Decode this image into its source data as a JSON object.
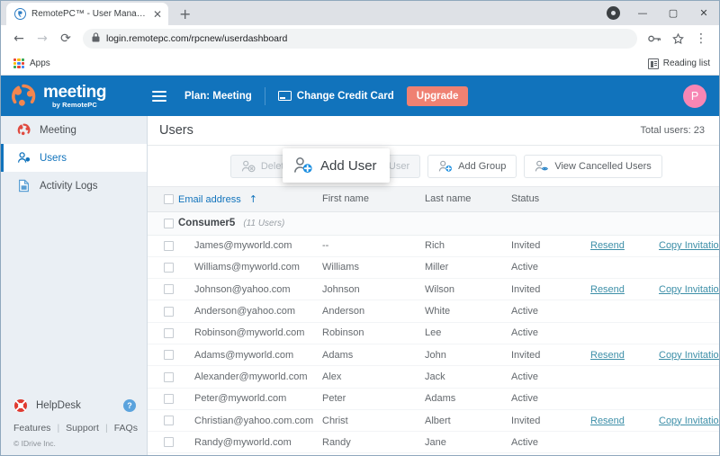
{
  "browser": {
    "tab": {
      "title": "RemotePC™ - User Management",
      "favicon": "remotepc-favicon",
      "close": "✕"
    },
    "new_tab": "+",
    "window_controls": {
      "minimize": "—",
      "maximize": "▢",
      "close": "✕"
    },
    "nav": {
      "back": "←",
      "forward": "→",
      "reload": "⟳"
    },
    "omnibox": {
      "url": "login.remotepc.com/rpcnew/userdashboard",
      "lock": "lock-icon",
      "key": "key-icon",
      "star": "star-icon",
      "menu": "⋮"
    },
    "bookmarks": {
      "apps_label": "Apps",
      "reading_list_label": "Reading list"
    }
  },
  "topbar": {
    "logo_main": "meeting",
    "logo_sub": "by RemotePC",
    "menu_icon": "hamburger-icon",
    "plan": "Plan: Meeting",
    "change_credit_card": "Change Credit Card",
    "upgrade": "Upgrade",
    "avatar_initial": "P",
    "bg_color": "#1173bc",
    "upgrade_color": "#ef8172",
    "avatar_color": "#f786b4"
  },
  "sidebar": {
    "items": [
      {
        "label": "Meeting",
        "icon": "meeting-icon",
        "active": false
      },
      {
        "label": "Users",
        "icon": "users-icon",
        "active": true
      },
      {
        "label": "Activity Logs",
        "icon": "activity-logs-icon",
        "active": false
      }
    ],
    "helpdesk": {
      "label": "HelpDesk",
      "icon": "lifebuoy-icon",
      "help_icon": "?"
    },
    "links": [
      "Features",
      "Support",
      "FAQs"
    ],
    "separator": "|",
    "copyright": "© IDrive Inc."
  },
  "content": {
    "page_title": "Users",
    "total_users": "Total users: 23",
    "toolbar": [
      {
        "label": "Add User",
        "icon": "add-user-icon",
        "disabled": false,
        "hovered": true
      },
      {
        "label": "Delete User",
        "icon": "delete-user-icon",
        "disabled": true,
        "hovered": false
      },
      {
        "label": "Move User",
        "icon": "move-user-icon",
        "disabled": true,
        "hovered": false
      },
      {
        "label": "Add Group",
        "icon": "add-group-icon",
        "disabled": false,
        "hovered": false
      },
      {
        "label": "View Cancelled Users",
        "icon": "view-cancelled-users-icon",
        "disabled": false,
        "hovered": false
      }
    ],
    "table": {
      "columns": [
        "Email address",
        "First name",
        "Last name",
        "Status"
      ],
      "sort_column": "Email address",
      "sort_arrow": "↑",
      "export_icon": "export-icon",
      "group": {
        "name": "Consumer5",
        "count": "(11 Users)",
        "collapse_icon": "chevron-up-icon"
      },
      "rows": [
        {
          "email": "James@myworld.com",
          "first": "--",
          "last": "Rich",
          "status": "Invited",
          "resend": "Resend",
          "copy": "Copy Invitation"
        },
        {
          "email": "Williams@myworld.com",
          "first": "Williams",
          "last": "Miller",
          "status": "Active",
          "resend": "",
          "copy": ""
        },
        {
          "email": "Johnson@yahoo.com",
          "first": "Johnson",
          "last": "Wilson",
          "status": "Invited",
          "resend": "Resend",
          "copy": "Copy Invitation"
        },
        {
          "email": "Anderson@yahoo.com",
          "first": "Anderson",
          "last": "White",
          "status": "Active",
          "resend": "",
          "copy": ""
        },
        {
          "email": "Robinson@myworld.com",
          "first": "Robinson",
          "last": "Lee",
          "status": "Active",
          "resend": "",
          "copy": ""
        },
        {
          "email": "Adams@myworld.com",
          "first": "Adams",
          "last": "John",
          "status": "Invited",
          "resend": "Resend",
          "copy": "Copy Invitation"
        },
        {
          "email": "Alexander@myworld.com",
          "first": "Alex",
          "last": "Jack",
          "status": "Active",
          "resend": "",
          "copy": ""
        },
        {
          "email": "Peter@myworld.com",
          "first": "Peter",
          "last": "Adams",
          "status": "Active",
          "resend": "",
          "copy": ""
        },
        {
          "email": "Christian@yahoo.com.com",
          "first": "Christ",
          "last": "Albert",
          "status": "Invited",
          "resend": "Resend",
          "copy": "Copy Invitation"
        },
        {
          "email": "Randy@myworld.com",
          "first": "Randy",
          "last": "Jane",
          "status": "Active",
          "resend": "",
          "copy": ""
        }
      ]
    },
    "status_colors": {
      "invited": "#e8912d",
      "active": "#64696e",
      "link": "#3d8fa8"
    }
  }
}
